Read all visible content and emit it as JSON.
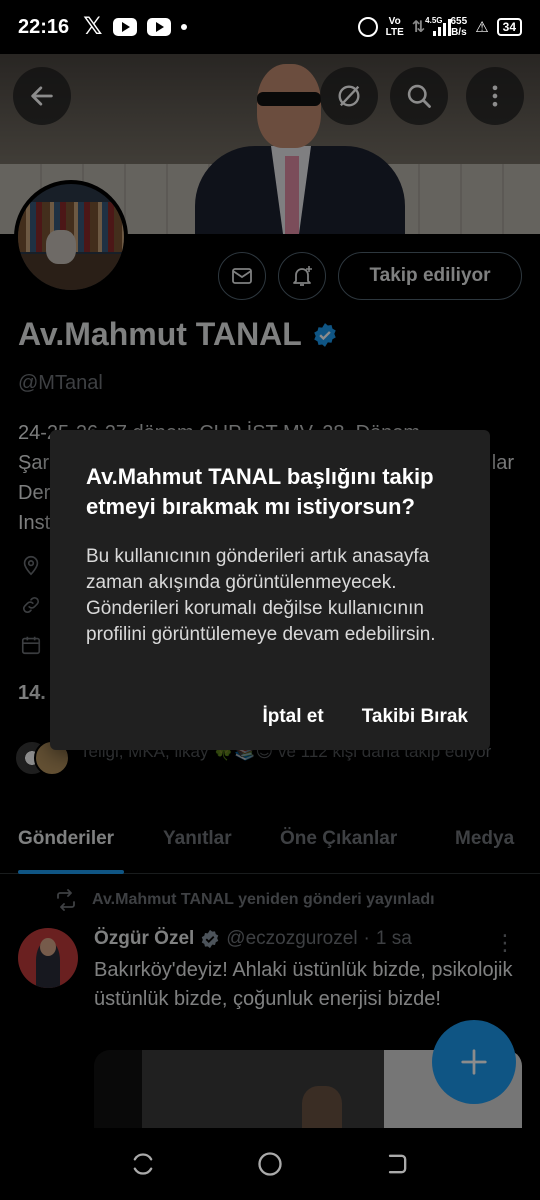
{
  "status_bar": {
    "time": "22:16",
    "network_label_top": "Vo",
    "network_label_bottom": "LTE",
    "net_type": "4.5G",
    "speed_value": "655",
    "speed_unit": "B/s",
    "battery": "34"
  },
  "profile": {
    "display_name": "Av.Mahmut TANAL",
    "handle": "@MTanal",
    "bio_line1": "24-25-26-27 dönem CHP İST MV. 28. Dönem",
    "bio_line2": "Şar",
    "bio_line2_end": "lar",
    "bio_line3": "Der",
    "bio_line4": "Inst",
    "stat_partial": "14.",
    "followers_known": "Teliği, MKA, likay 🍀📚😊 ve 112 kişi daha takip ediyor",
    "follow_button_label": "Takip ediliyor"
  },
  "tabs": [
    {
      "label": "Gönderiler",
      "active": true
    },
    {
      "label": "Yanıtlar",
      "active": false
    },
    {
      "label": "Öne Çıkanlar",
      "active": false
    },
    {
      "label": "Medya",
      "active": false
    }
  ],
  "post": {
    "repost_label": "Av.Mahmut TANAL yeniden gönderi yayınladı",
    "author": "Özgür Özel",
    "handle": "@eczozgurozel",
    "separator": "·",
    "time": "1 sa",
    "text": "Bakırköy'deyiz! Ahlaki üstünlük bizde, psikolojik üstünlük bizde, çoğunluk enerjisi bizde!"
  },
  "dialog": {
    "title": "Av.Mahmut TANAL başlığını takip etmeyi bırakmak mı istiyorsun?",
    "body": "Bu kullanıcının gönderileri artık anasayfa zaman akışında görüntülenmeyecek. Gönderileri korumalı değilse kullanıcının profilini görüntülemeye devam edebilirsin.",
    "cancel_label": "İptal et",
    "confirm_label": "Takibi Bırak"
  },
  "colors": {
    "accent": "#1d9bf0",
    "background": "#000000",
    "dialog_bg": "#202020",
    "muted_text": "#71767b"
  },
  "icons": {
    "back": "arrow-left-icon",
    "no_notifications": "circle-slash-icon",
    "search": "search-icon",
    "more": "more-vertical-icon",
    "message": "envelope-icon",
    "notify": "bell-plus-icon",
    "location": "location-pin-icon",
    "link": "link-icon",
    "calendar": "calendar-icon",
    "repost": "repost-icon",
    "compose": "plus-icon"
  }
}
